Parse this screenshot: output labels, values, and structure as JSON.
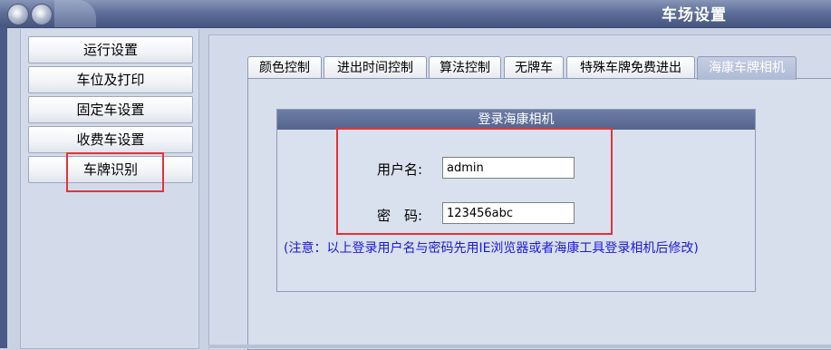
{
  "window": {
    "title": "车场设置"
  },
  "sidebar": {
    "items": [
      {
        "label": "运行设置"
      },
      {
        "label": "车位及打印"
      },
      {
        "label": "固定车设置"
      },
      {
        "label": "收费车设置"
      },
      {
        "label": "车牌识别"
      }
    ],
    "selected_index": 4
  },
  "tabs": [
    {
      "label": "颜色控制"
    },
    {
      "label": "进出时间控制"
    },
    {
      "label": "算法控制"
    },
    {
      "label": "无牌车"
    },
    {
      "label": "特殊车牌免费进出"
    },
    {
      "label": "海康车牌相机"
    }
  ],
  "active_tab_index": 5,
  "login_group": {
    "title": "登录海康相机",
    "username_label": "用户名:",
    "username_value": "admin",
    "password_label": "密　码:",
    "password_value": "123456abc",
    "note": "(注意：以上登录用户名与密码先用IE浏览器或者海康工具登录相机后修改)"
  },
  "colors": {
    "highlight": "#e0343a",
    "note": "#1a1ae0",
    "titlebar": "#5f6f99"
  }
}
